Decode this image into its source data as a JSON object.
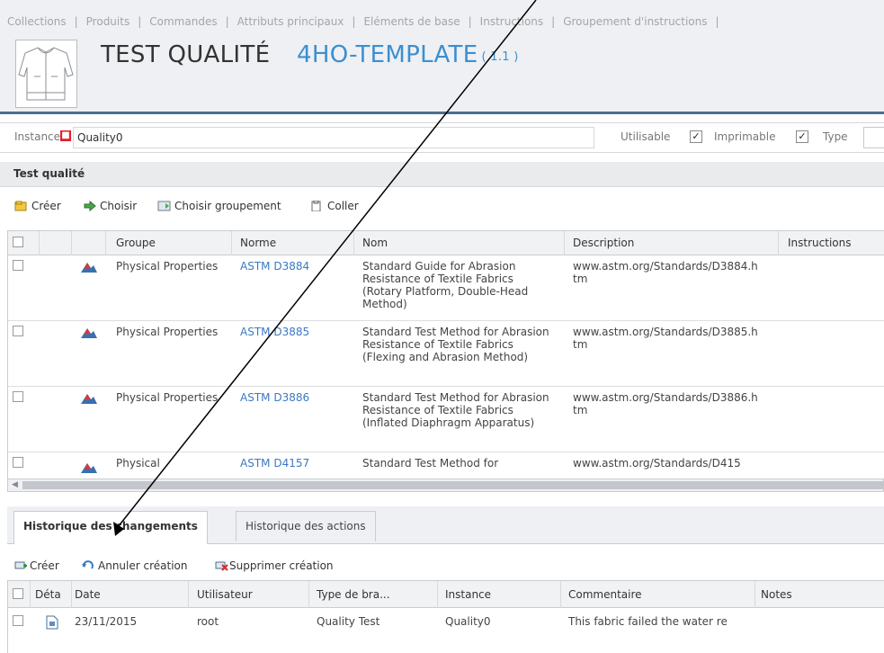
{
  "nav": {
    "items": [
      "Collections",
      "Produits",
      "Commandes",
      "Attributs principaux",
      "Eléments de base",
      "Instructions",
      "Groupement d'instructions"
    ]
  },
  "header": {
    "product_title": "TEST QUALITÉ",
    "template_title": "4HO-TEMPLATE",
    "template_version": "( 1.1 )"
  },
  "instance": {
    "label": "Instance",
    "value": "Quality0",
    "utilisable_label": "Utilisable",
    "utilisable_checked": true,
    "imprimable_label": "Imprimable",
    "imprimable_checked": true,
    "type_label": "Type"
  },
  "test_qualite": {
    "title": "Test qualité",
    "toolbar": {
      "creer": "Créer",
      "choisir": "Choisir",
      "choisir_groupement": "Choisir groupement",
      "coller": "Coller"
    },
    "columns": [
      "Groupe",
      "Norme",
      "Nom",
      "Description",
      "Instructions"
    ],
    "rows": [
      {
        "groupe": "Physical Properties",
        "norme": "ASTM D3884",
        "nom": "Standard Guide for Abrasion Resistance of Textile Fabrics (Rotary Platform, Double-Head Method)",
        "description": "www.astm.org/Standards/D3884.htm"
      },
      {
        "groupe": "Physical Properties",
        "norme": "ASTM D3885",
        "nom": "Standard Test Method for Abrasion Resistance of Textile Fabrics (Flexing and Abrasion Method)",
        "description": "www.astm.org/Standards/D3885.htm"
      },
      {
        "groupe": "Physical Properties",
        "norme": "ASTM D3886",
        "nom": "Standard Test Method for Abrasion Resistance of Textile Fabrics (Inflated Diaphragm Apparatus)",
        "description": "www.astm.org/Standards/D3886.htm"
      },
      {
        "groupe": "Physical",
        "norme": "ASTM D4157",
        "nom": "Standard Test Method for",
        "description": "www.astm.org/Standards/D415"
      }
    ]
  },
  "bottom_tabs": {
    "history": "Historique des changements",
    "actions": "Historique des actions"
  },
  "history": {
    "toolbar": {
      "creer": "Créer",
      "annuler": "Annuler création",
      "supprimer": "Supprimer création"
    },
    "columns": [
      "Déta",
      "Date",
      "Utilisateur",
      "Type de bra...",
      "Instance",
      "Commentaire",
      "Notes"
    ],
    "rows": [
      {
        "date": "23/11/2015",
        "utilisateur": "root",
        "type": "Quality Test",
        "instance": "Quality0",
        "commentaire": "This fabric failed the water re"
      }
    ]
  },
  "colors": {
    "link": "#3b79c3",
    "template_title": "#3b8fd0",
    "required": "#e0202a",
    "header_border": "#4b6f8f"
  },
  "icons": [
    "jacket-thumbnail",
    "required-icon",
    "create-icon",
    "choose-icon",
    "choose-group-icon",
    "paste-icon",
    "group-mountain-icon",
    "document-icon",
    "undo-icon",
    "delete-icon"
  ]
}
